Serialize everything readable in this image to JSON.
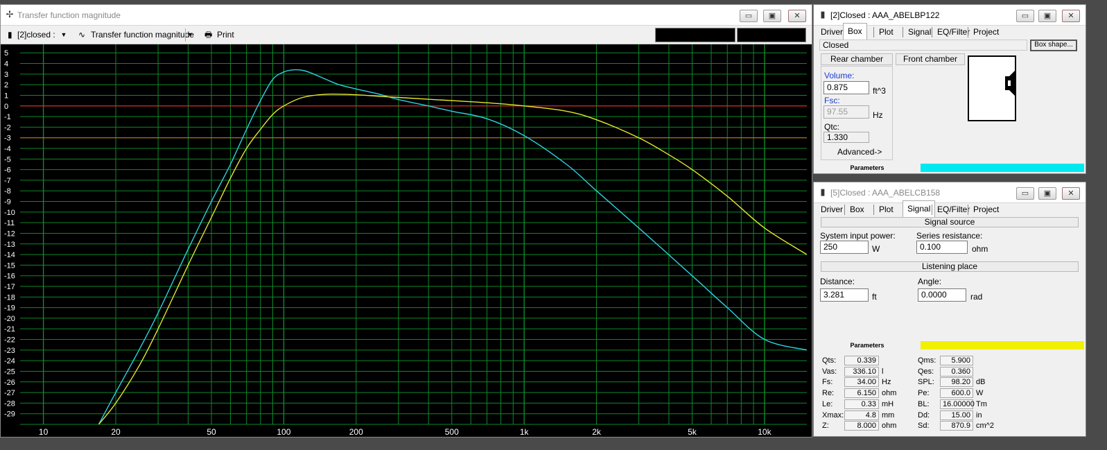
{
  "plot_window": {
    "title": "Transfer function magnitude",
    "toolbar": {
      "project_select": "[2]closed :",
      "mode_select": "Transfer function magnitude",
      "print_label": "Print"
    }
  },
  "chart_data": {
    "type": "line",
    "title": "",
    "xlabel": "",
    "ylabel": "",
    "x_scale": "log",
    "xlim": [
      8,
      15000
    ],
    "ylim": [
      -30,
      5.5
    ],
    "x_tick_labels": [
      "10",
      "20",
      "50",
      "100",
      "200",
      "500",
      "1k",
      "2k",
      "5k",
      "10k"
    ],
    "x_tick_values": [
      10,
      20,
      50,
      100,
      200,
      500,
      1000,
      2000,
      5000,
      10000
    ],
    "y_tick_labels": [
      "5",
      "4",
      "3",
      "2",
      "1",
      "0",
      "-1",
      "-2",
      "-3",
      "-4",
      "-5",
      "-6",
      "-7",
      "-8",
      "-9",
      "-10",
      "-11",
      "-12",
      "-13",
      "-14",
      "-15",
      "-16",
      "-17",
      "-18",
      "-19",
      "-20",
      "-21",
      "-22",
      "-23",
      "-24",
      "-25",
      "-26",
      "-27",
      "-28",
      "-29"
    ],
    "reference_lines": [
      {
        "y": 0,
        "color": "#e02020"
      },
      {
        "y": -3,
        "color": "#e06010"
      }
    ],
    "grid": true,
    "grid_color": "#0e8a2a",
    "series": [
      {
        "color": "#2ed2e0",
        "x": [
          17,
          20,
          25,
          30,
          40,
          50,
          60,
          70,
          80,
          90,
          100,
          110,
          120,
          130,
          150,
          170,
          200,
          250,
          300,
          400,
          500,
          700,
          1000,
          1500,
          2000,
          3000,
          5000,
          7000,
          10000,
          15000
        ],
        "y": [
          -30,
          -27,
          -23,
          -19.5,
          -13.5,
          -9,
          -5.5,
          -2.2,
          0.5,
          2.5,
          3.2,
          3.4,
          3.35,
          3.1,
          2.5,
          2.0,
          1.6,
          1.1,
          0.6,
          0.0,
          -0.5,
          -1.2,
          -2.8,
          -5.5,
          -8.0,
          -11.5,
          -16,
          -19,
          -22,
          -23
        ]
      },
      {
        "color": "#e6e630",
        "x": [
          17,
          20,
          25,
          30,
          40,
          50,
          60,
          70,
          80,
          90,
          100,
          120,
          150,
          200,
          250,
          300,
          500,
          700,
          1000,
          1500,
          2000,
          3000,
          4000,
          5000,
          7000,
          10000,
          15000
        ],
        "y": [
          -30,
          -28,
          -24.5,
          -21,
          -15,
          -10.5,
          -6.8,
          -4.0,
          -2.2,
          -0.8,
          0.0,
          0.8,
          1.1,
          1.05,
          0.9,
          0.8,
          0.5,
          0.3,
          0.0,
          -0.5,
          -1.3,
          -3.0,
          -4.6,
          -6.0,
          -8.5,
          -11.5,
          -14
        ]
      }
    ]
  },
  "box_window": {
    "title": "[2]Closed : AAA_ABELBP122",
    "tabs": [
      "Driver",
      "Box",
      "Plot",
      "Signal",
      "EQ/Filter",
      "Project"
    ],
    "selected_tab": "Box",
    "box_type": "Closed",
    "box_shape_button": "Box shape...",
    "rear_chamber_button": "Rear chamber",
    "front_chamber_button": "Front chamber",
    "volume_label": "Volume:",
    "volume_value": "0.875",
    "volume_unit": "ft^3",
    "fsc_label": "Fsc:",
    "fsc_value": "97.55",
    "fsc_unit": "Hz",
    "qtc_label": "Qtc:",
    "qtc_value": "1.330",
    "advanced_button": "Advanced->",
    "params_label": "Parameters",
    "params_color": "#00e8f0"
  },
  "signal_window": {
    "title": "[5]Closed : AAA_ABELCB158",
    "tabs": [
      "Driver",
      "Box",
      "Plot",
      "Signal",
      "EQ/Filter",
      "Project"
    ],
    "selected_tab": "Signal",
    "signal_source_label": "Signal source",
    "input_power_label": "System input power:",
    "input_power_value": "250",
    "input_power_unit": "W",
    "series_res_label": "Series resistance:",
    "series_res_value": "0.100",
    "series_res_unit": "ohm",
    "listening_place_label": "Listening place",
    "distance_label": "Distance:",
    "distance_value": "3.281",
    "distance_unit": "ft",
    "angle_label": "Angle:",
    "angle_value": "0.0000",
    "angle_unit": "rad",
    "params_label": "Parameters",
    "params_color": "#f0f000",
    "params_left": [
      {
        "label": "Qts:",
        "value": "0.339",
        "unit": ""
      },
      {
        "label": "Vas:",
        "value": "336.10",
        "unit": "l"
      },
      {
        "label": "Fs:",
        "value": "34.00",
        "unit": "Hz"
      },
      {
        "label": "Re:",
        "value": "6.150",
        "unit": "ohm"
      },
      {
        "label": "Le:",
        "value": "0.33",
        "unit": "mH"
      },
      {
        "label": "Xmax:",
        "value": "4.8",
        "unit": "mm"
      },
      {
        "label": "Z:",
        "value": "8.000",
        "unit": "ohm"
      }
    ],
    "params_right": [
      {
        "label": "Qms:",
        "value": "5.900",
        "unit": ""
      },
      {
        "label": "Qes:",
        "value": "0.360",
        "unit": ""
      },
      {
        "label": "SPL:",
        "value": "98.20",
        "unit": "dB"
      },
      {
        "label": "Pe:",
        "value": "600.0",
        "unit": "W"
      },
      {
        "label": "BL:",
        "value": "16.00000",
        "unit": "Tm"
      },
      {
        "label": "Dd:",
        "value": "15.00",
        "unit": "in"
      },
      {
        "label": "Sd:",
        "value": "870.9",
        "unit": "cm^2"
      }
    ]
  }
}
